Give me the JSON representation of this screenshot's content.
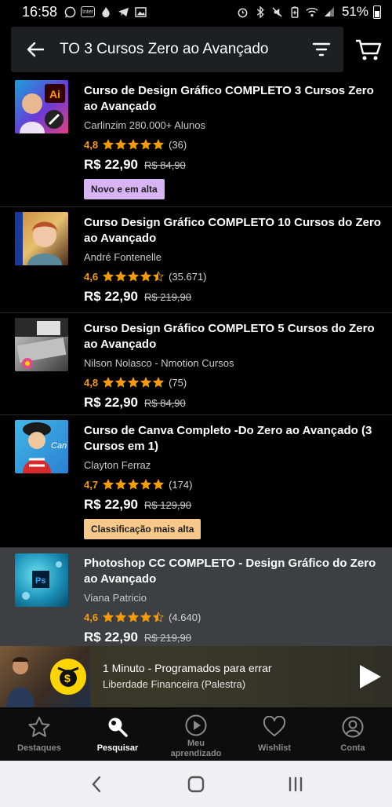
{
  "status_bar": {
    "time": "16:58",
    "battery": "51%",
    "left_icons": [
      "whatsapp-icon",
      "inter-icon",
      "fire-icon",
      "telegram-icon",
      "gallery-icon"
    ],
    "inter_label": "Inter",
    "right_icons": [
      "alarm-icon",
      "bluetooth-icon",
      "mute-icon",
      "battery-saver-icon",
      "wifi-icon",
      "signal-icon"
    ]
  },
  "header": {
    "search_query": "TO 3 Cursos Zero ao Avançado",
    "back_icon": "arrow-left-icon",
    "filter_icon": "filter-icon",
    "cart_icon": "cart-icon"
  },
  "courses": [
    {
      "title": "Curso de Design Gráfico COMPLETO 3 Cursos Zero ao Avançado",
      "author": "Carlinzim 280.000+ Alunos",
      "rating": "4,8",
      "stars": 5,
      "count": "(36)",
      "price": "R$ 22,90",
      "old_price": "R$ 84,90",
      "badge": "Novo e em alta",
      "thumb_label": "Ai"
    },
    {
      "title": "Curso Design Gráfico COMPLETO 10 Cursos do Zero ao Avançado",
      "author": "André Fontenelle",
      "rating": "4,6",
      "stars": 4.5,
      "count": "(35.671)",
      "price": "R$ 22,90",
      "old_price": "R$ 219,90"
    },
    {
      "title": "Curso Design Gráfico COMPLETO 5 Cursos do Zero ao Avançado",
      "author": "Nilson Nolasco - Nmotion Cursos",
      "rating": "4,8",
      "stars": 5,
      "count": "(75)",
      "price": "R$ 22,90",
      "old_price": "R$ 84,90"
    },
    {
      "title": "Curso de Canva Completo -Do Zero ao Avançado (3 Cursos em 1)",
      "author": "Clayton Ferraz",
      "rating": "4,7",
      "stars": 5,
      "count": "(174)",
      "price": "R$ 22,90",
      "old_price": "R$ 129,90",
      "badge": "Classificação mais alta",
      "thumb_label": "Can"
    },
    {
      "title": "Photoshop CC COMPLETO - Design Gráfico do Zero ao Avançado",
      "author": "Viana Patricio",
      "rating": "4,6",
      "stars": 4.5,
      "count": "(4.640)",
      "price": "R$ 22,90",
      "old_price": "R$ 219,90",
      "thumb_label": "Ps"
    }
  ],
  "mini_player": {
    "title": "1 Minuto - Programados para errar",
    "subtitle": "Liberdade Financeira (Palestra)",
    "play_icon": "play-icon"
  },
  "bottom_nav": [
    {
      "label": "Destaques",
      "icon": "star-icon",
      "active": false
    },
    {
      "label": "Pesquisar",
      "icon": "search-icon",
      "active": true
    },
    {
      "label": "Meu aprendizado",
      "icon": "play-circle-icon",
      "active": false
    },
    {
      "label": "Wishlist",
      "icon": "heart-icon",
      "active": false
    },
    {
      "label": "Conta",
      "icon": "account-icon",
      "active": false
    }
  ],
  "colors": {
    "rating_orange": "#f69c08",
    "badge_new": "#d8b4f4",
    "badge_top": "#f6c98b",
    "highlight_row": "#3e3f42"
  }
}
